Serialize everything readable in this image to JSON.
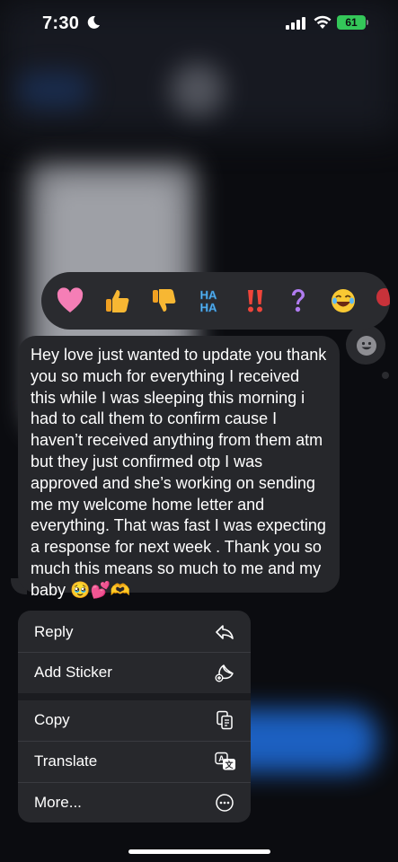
{
  "status_bar": {
    "time": "7:30",
    "battery": "61"
  },
  "reactions": [
    {
      "icon": "heart-emoji",
      "glyph": "❤"
    },
    {
      "icon": "thumbs-up-emoji",
      "glyph": "👍"
    },
    {
      "icon": "thumbs-down-emoji",
      "glyph": "👎"
    },
    {
      "icon": "haha-emoji",
      "glyph": "HA\nHA"
    },
    {
      "icon": "exclamation-emoji",
      "glyph": "‼"
    },
    {
      "icon": "question-emoji",
      "glyph": "?"
    },
    {
      "icon": "laughing-emoji",
      "glyph": "😂"
    },
    {
      "icon": "balloon-emoji",
      "glyph": "🎈"
    }
  ],
  "message": {
    "text": "Hey love just wanted to update you thank you so much for everything I received this while I was sleeping this morning i had to call them to confirm cause I haven’t received anything from them atm but they just confirmed otp I was approved and she’s working on sending me my welcome home letter and everything. That was fast I was expecting a response for next week . Thank you so much this means so much to me and my baby 🥹💕🫶"
  },
  "menu": {
    "reply": "Reply",
    "add_sticker": "Add Sticker",
    "copy": "Copy",
    "translate": "Translate",
    "more": "More..."
  },
  "colors": {
    "battery": "#34c759",
    "bubble": "#26272b",
    "menu": "#27282c"
  }
}
